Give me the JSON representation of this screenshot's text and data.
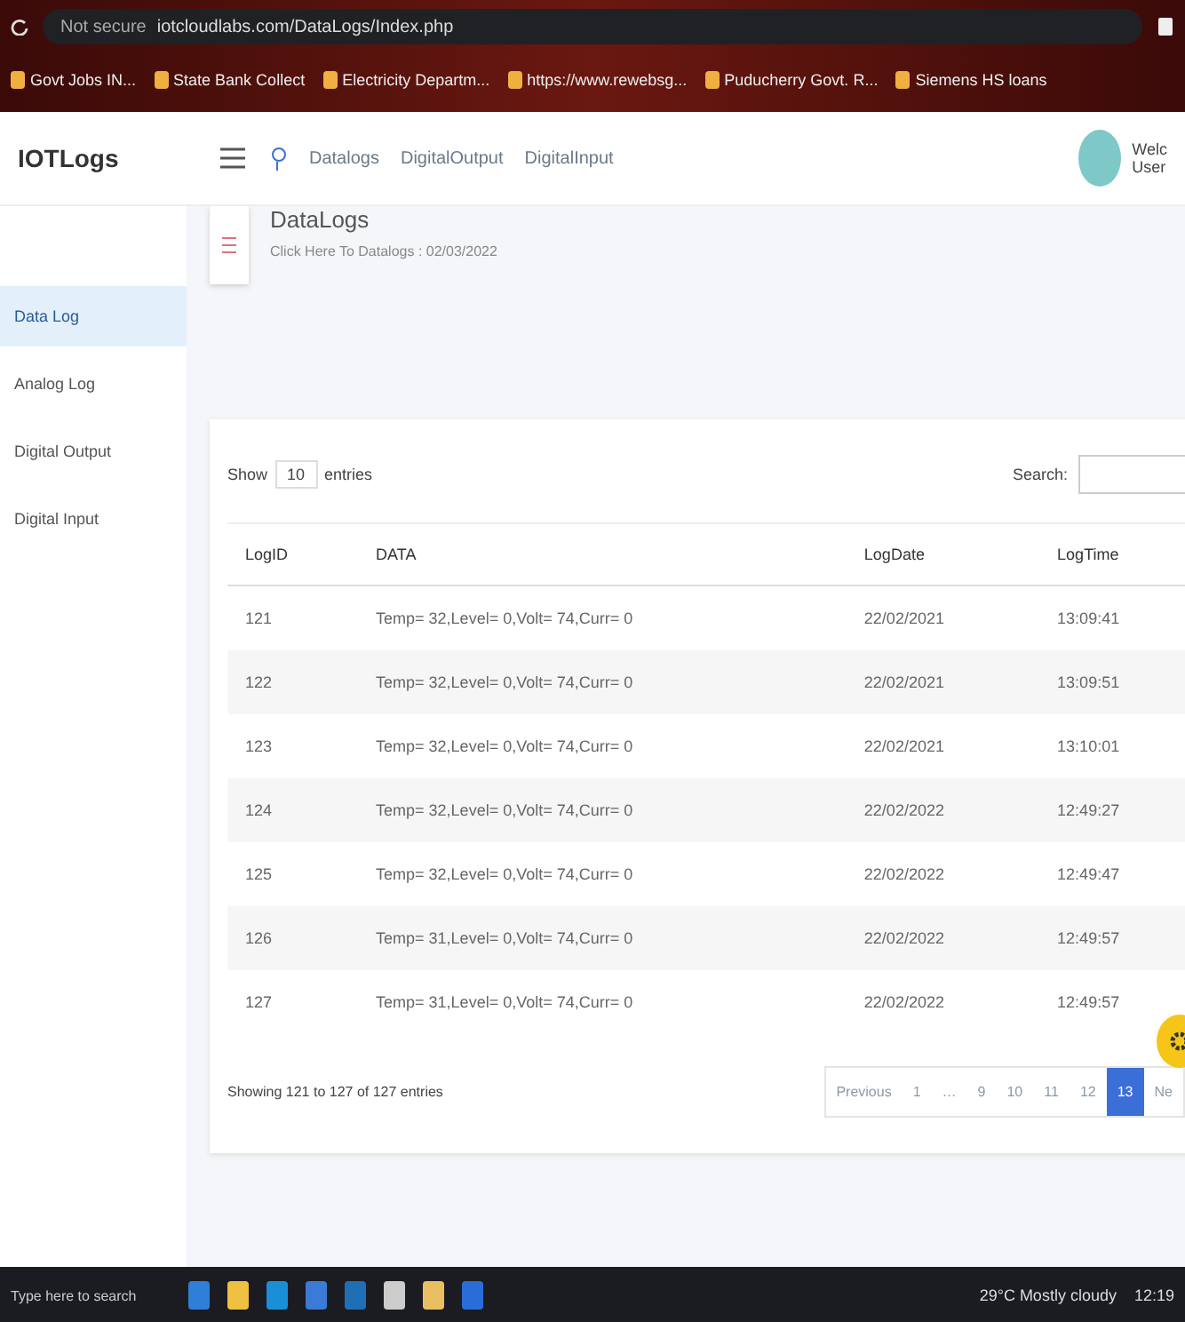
{
  "browser": {
    "security": "Not secure",
    "url": "iotcloudlabs.com/DataLogs/Index.php",
    "bookmarks": [
      "Govt Jobs IN...",
      "State Bank Collect",
      "Electricity Departm...",
      "https://www.rewebsg...",
      "Puducherry Govt. R...",
      "Siemens HS loans"
    ]
  },
  "header": {
    "logo": "IOTLogs",
    "nav": [
      "Datalogs",
      "DigitalOutput",
      "DigitalInput"
    ],
    "user_name": "Welc",
    "user_role": "User"
  },
  "sidebar": {
    "items": [
      {
        "label": "Data Log",
        "selected": true
      },
      {
        "label": "Analog Log",
        "selected": false
      },
      {
        "label": "Digital Output",
        "selected": false
      },
      {
        "label": "Digital Input",
        "selected": false
      }
    ]
  },
  "page": {
    "title": "DataLogs",
    "subtitle": "Click Here To Datalogs : 02/03/2022"
  },
  "table": {
    "show_label": "Show",
    "entries_value": "10",
    "entries_label": "entries",
    "search_label": "Search:",
    "columns": [
      "LogID",
      "DATA",
      "LogDate",
      "LogTime"
    ],
    "rows": [
      [
        "121",
        "Temp= 32,Level= 0,Volt= 74,Curr= 0",
        "22/02/2021",
        "13:09:41"
      ],
      [
        "122",
        "Temp= 32,Level= 0,Volt= 74,Curr= 0",
        "22/02/2021",
        "13:09:51"
      ],
      [
        "123",
        "Temp= 32,Level= 0,Volt= 74,Curr= 0",
        "22/02/2021",
        "13:10:01"
      ],
      [
        "124",
        "Temp= 32,Level= 0,Volt= 74,Curr= 0",
        "22/02/2022",
        "12:49:27"
      ],
      [
        "125",
        "Temp= 32,Level= 0,Volt= 74,Curr= 0",
        "22/02/2022",
        "12:49:47"
      ],
      [
        "126",
        "Temp= 31,Level= 0,Volt= 74,Curr= 0",
        "22/02/2022",
        "12:49:57"
      ],
      [
        "127",
        "Temp= 31,Level= 0,Volt= 74,Curr= 0",
        "22/02/2022",
        "12:49:57"
      ]
    ],
    "info": "Showing 121 to 127 of 127 entries",
    "pages": [
      {
        "label": "Previous",
        "selected": false
      },
      {
        "label": "1",
        "selected": false
      },
      {
        "label": "…",
        "selected": false
      },
      {
        "label": "9",
        "selected": false
      },
      {
        "label": "10",
        "selected": false
      },
      {
        "label": "11",
        "selected": false
      },
      {
        "label": "12",
        "selected": false
      },
      {
        "label": "13",
        "selected": true
      },
      {
        "label": "Ne",
        "selected": false
      }
    ]
  },
  "taskbar": {
    "search_placeholder": "Type here to search",
    "weather": "29°C Mostly cloudy",
    "time": "12:19"
  }
}
